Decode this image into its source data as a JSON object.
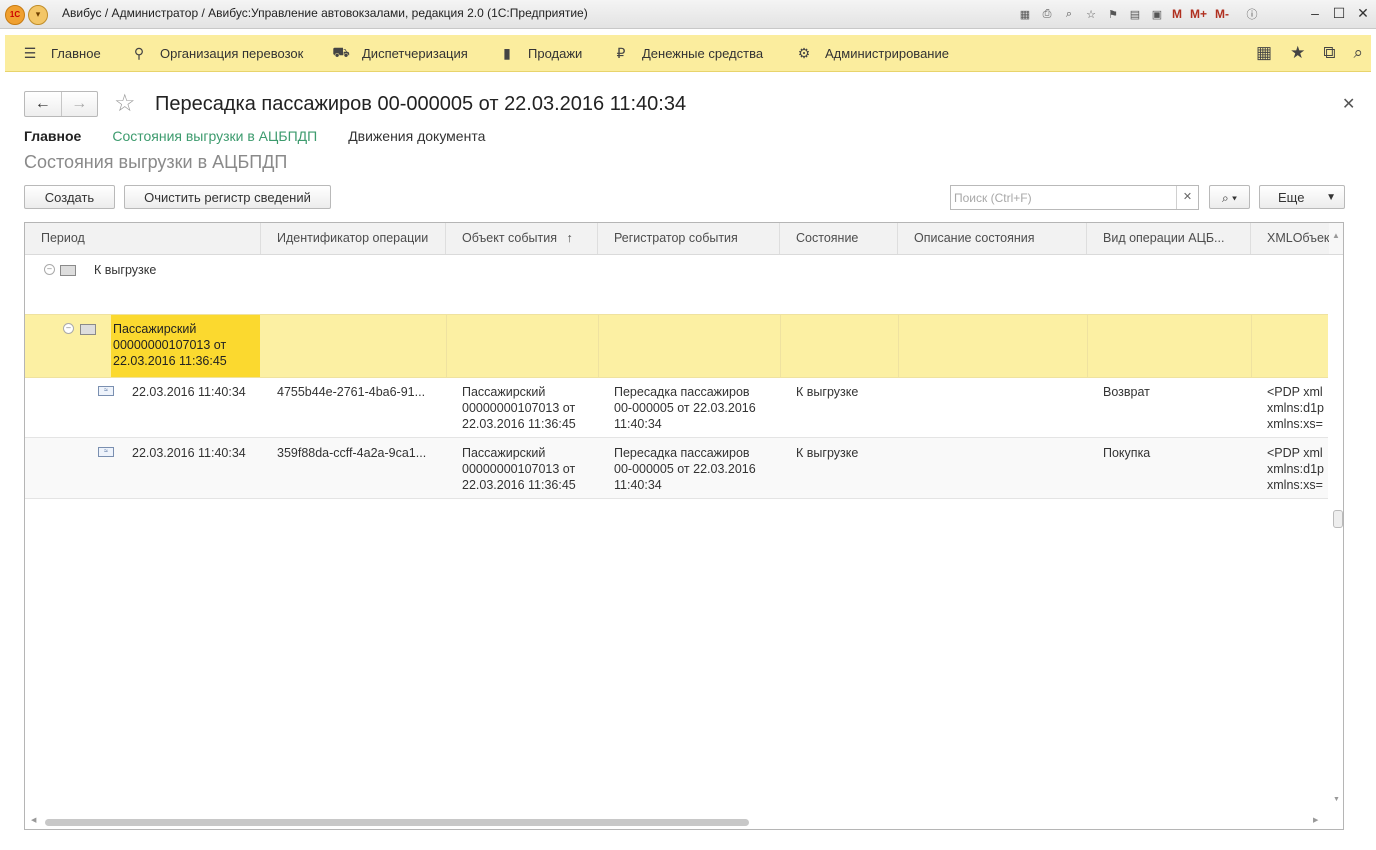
{
  "window": {
    "title": "Авибус / Администратор / Авибус:Управление автовокзалами, редакция 2.0  (1С:Предприятие)",
    "tools": [
      "M",
      "M+",
      "M-"
    ]
  },
  "sections": [
    {
      "label": "Главное",
      "icon": "menu-icon"
    },
    {
      "label": "Организация перевозок",
      "icon": "pin-icon"
    },
    {
      "label": "Диспетчеризация",
      "icon": "bus-icon"
    },
    {
      "label": "Продажи",
      "icon": "bag-icon"
    },
    {
      "label": "Денежные средства",
      "icon": "ruble-icon"
    },
    {
      "label": "Администрирование",
      "icon": "gear-icon"
    }
  ],
  "form": {
    "title": "Пересадка пассажиров 00-000005 от 22.03.2016 11:40:34",
    "tabs": [
      "Главное",
      "Состояния выгрузки в АЦБПДП",
      "Движения документа"
    ],
    "subtitle": "Состояния выгрузки в АЦБПДП"
  },
  "toolbar": {
    "create_label": "Создать",
    "clear_label": "Очистить регистр сведений",
    "search_placeholder": "Поиск (Ctrl+F)",
    "more_label": "Еще"
  },
  "table": {
    "columns": [
      "Период",
      "Идентификатор операции",
      "Объект события",
      "Регистратор события",
      "Состояние",
      "Описание состояния",
      "Вид операции АЦБ...",
      "XMLОбъект"
    ],
    "sort_column_index": 2,
    "group_level1": "К выгрузке",
    "group_level2": "Пассажирский\n00000000107013 от\n22.03.2016 11:36:45",
    "rows": [
      {
        "period": "22.03.2016 11:40:34",
        "operation_id": "4755b44e-2761-4ba6-91...",
        "object": "Пассажирский\n00000000107013 от\n22.03.2016 11:36:45",
        "registrar": "Пересадка пассажиров\n00-000005 от 22.03.2016\n11:40:34",
        "state": "К выгрузке",
        "state_description": "",
        "operation_type": "Возврат",
        "xml": "<PDP xml\nxmlns:d1p\nxmlns:xs="
      },
      {
        "period": "22.03.2016 11:40:34",
        "operation_id": "359f88da-ccff-4a2a-9ca1...",
        "object": "Пассажирский\n00000000107013 от\n22.03.2016 11:36:45",
        "registrar": "Пересадка пассажиров\n00-000005 от 22.03.2016\n11:40:34",
        "state": "К выгрузке",
        "state_description": "",
        "operation_type": "Покупка",
        "xml": "<PDP xml\nxmlns:d1p\nxmlns:xs="
      }
    ]
  },
  "colors": {
    "section_panel": "#fbed9e",
    "selected_row": "#fcf0a3",
    "selected_cell": "#fbd92f",
    "link": "#3d9b6e"
  }
}
